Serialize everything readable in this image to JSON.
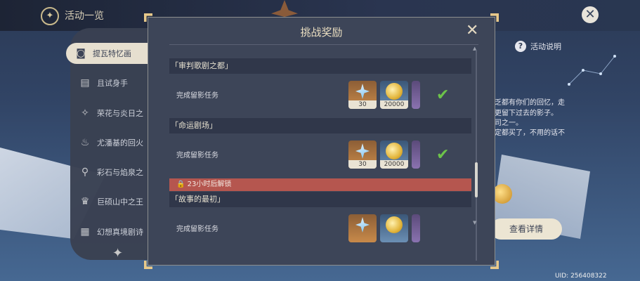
{
  "header": {
    "title": "活动一览",
    "icon": "compass-icon",
    "close_icon": "close-icon"
  },
  "sidebar": {
    "items": [
      {
        "label": "提瓦特忆画",
        "icon": "camera-icon",
        "active": true
      },
      {
        "label": "且试身手",
        "icon": "cards-icon",
        "active": false
      },
      {
        "label": "荣花与炎日之",
        "icon": "flower-icon",
        "active": false
      },
      {
        "label": "尤潘基的回火",
        "icon": "flame-icon",
        "active": false
      },
      {
        "label": "彩石与焰泉之",
        "icon": "map-pin-icon",
        "active": false
      },
      {
        "label": "巨硕山中之王",
        "icon": "mountain-crown-icon",
        "active": false
      },
      {
        "label": "幻想真境剧诗",
        "icon": "book-icon",
        "active": false
      }
    ]
  },
  "background": {
    "help_label": "活动说明",
    "text_lines": [
      "乏都有你们的回忆，走",
      "更留下过去的影子。",
      "司之一。",
      "定都买了，不用的话不"
    ],
    "detail_button": "查看详情",
    "uid": "UID: 256408322"
  },
  "modal": {
    "title": "挑战奖励",
    "close_icon": "close-x-icon",
    "sections": [
      {
        "header": "「审判歌剧之都」",
        "locked": false,
        "task": "完成留影任务",
        "rewards": [
          {
            "type": "primogem",
            "count": "30"
          },
          {
            "type": "mora",
            "count": "20000"
          }
        ],
        "claimed": true
      },
      {
        "header": "「命运剧场」",
        "locked": false,
        "task": "完成留影任务",
        "rewards": [
          {
            "type": "primogem",
            "count": "30"
          },
          {
            "type": "mora",
            "count": "20000"
          }
        ],
        "claimed": true
      },
      {
        "header": "「故事的最初」",
        "locked": true,
        "lock_text": "23小时后解锁",
        "task": "完成留影任务",
        "rewards": [
          {
            "type": "primogem",
            "count": ""
          },
          {
            "type": "mora",
            "count": ""
          }
        ],
        "claimed": false
      }
    ]
  },
  "colors": {
    "accent": "#ece5d3",
    "lock_bar": "#b5564f",
    "check": "#6cc34a",
    "modal_bg": "#3d4558"
  }
}
